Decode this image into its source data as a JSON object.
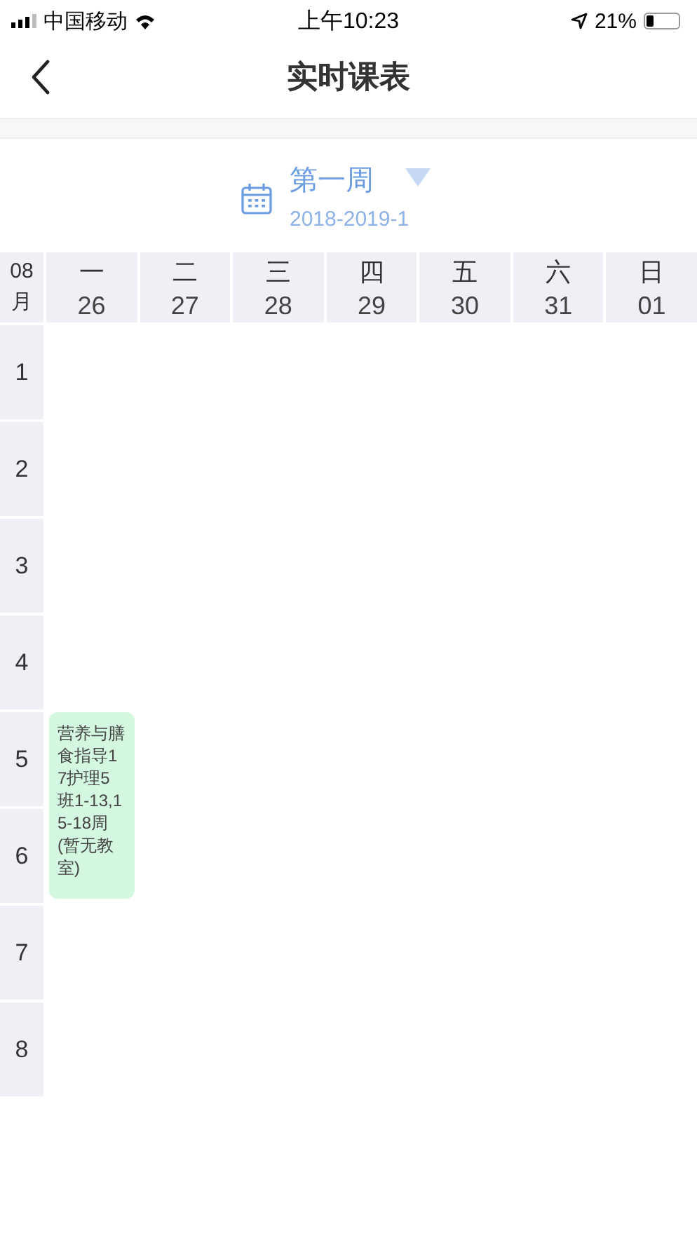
{
  "status_bar": {
    "carrier": "中国移动",
    "time": "上午10:23",
    "battery": "21%"
  },
  "nav": {
    "title": "实时课表"
  },
  "week_selector": {
    "week": "第一周",
    "term": "2018-2019-1"
  },
  "timetable": {
    "month_number": "08",
    "month_unit": "月",
    "days": [
      {
        "weekday": "一",
        "date": "26",
        "slots": [
          {
            "kind": "free"
          },
          {
            "kind": "free"
          },
          {
            "kind": "free"
          },
          {
            "kind": "free"
          },
          {
            "kind": "course",
            "text": "营养与膳食指导17护理5班1-13,15-18周(暂无教室)",
            "color": "#d4f7df"
          },
          {
            "kind": "continued"
          }
        ]
      },
      {
        "weekday": "二",
        "date": "27"
      },
      {
        "weekday": "三",
        "date": "28"
      },
      {
        "weekday": "四",
        "date": "29"
      },
      {
        "weekday": "五",
        "date": "30"
      },
      {
        "weekday": "六",
        "date": "31"
      },
      {
        "weekday": "日",
        "date": "01"
      }
    ],
    "periods": [
      "1",
      "2",
      "3",
      "4",
      "5",
      "6",
      "7",
      "8"
    ]
  }
}
